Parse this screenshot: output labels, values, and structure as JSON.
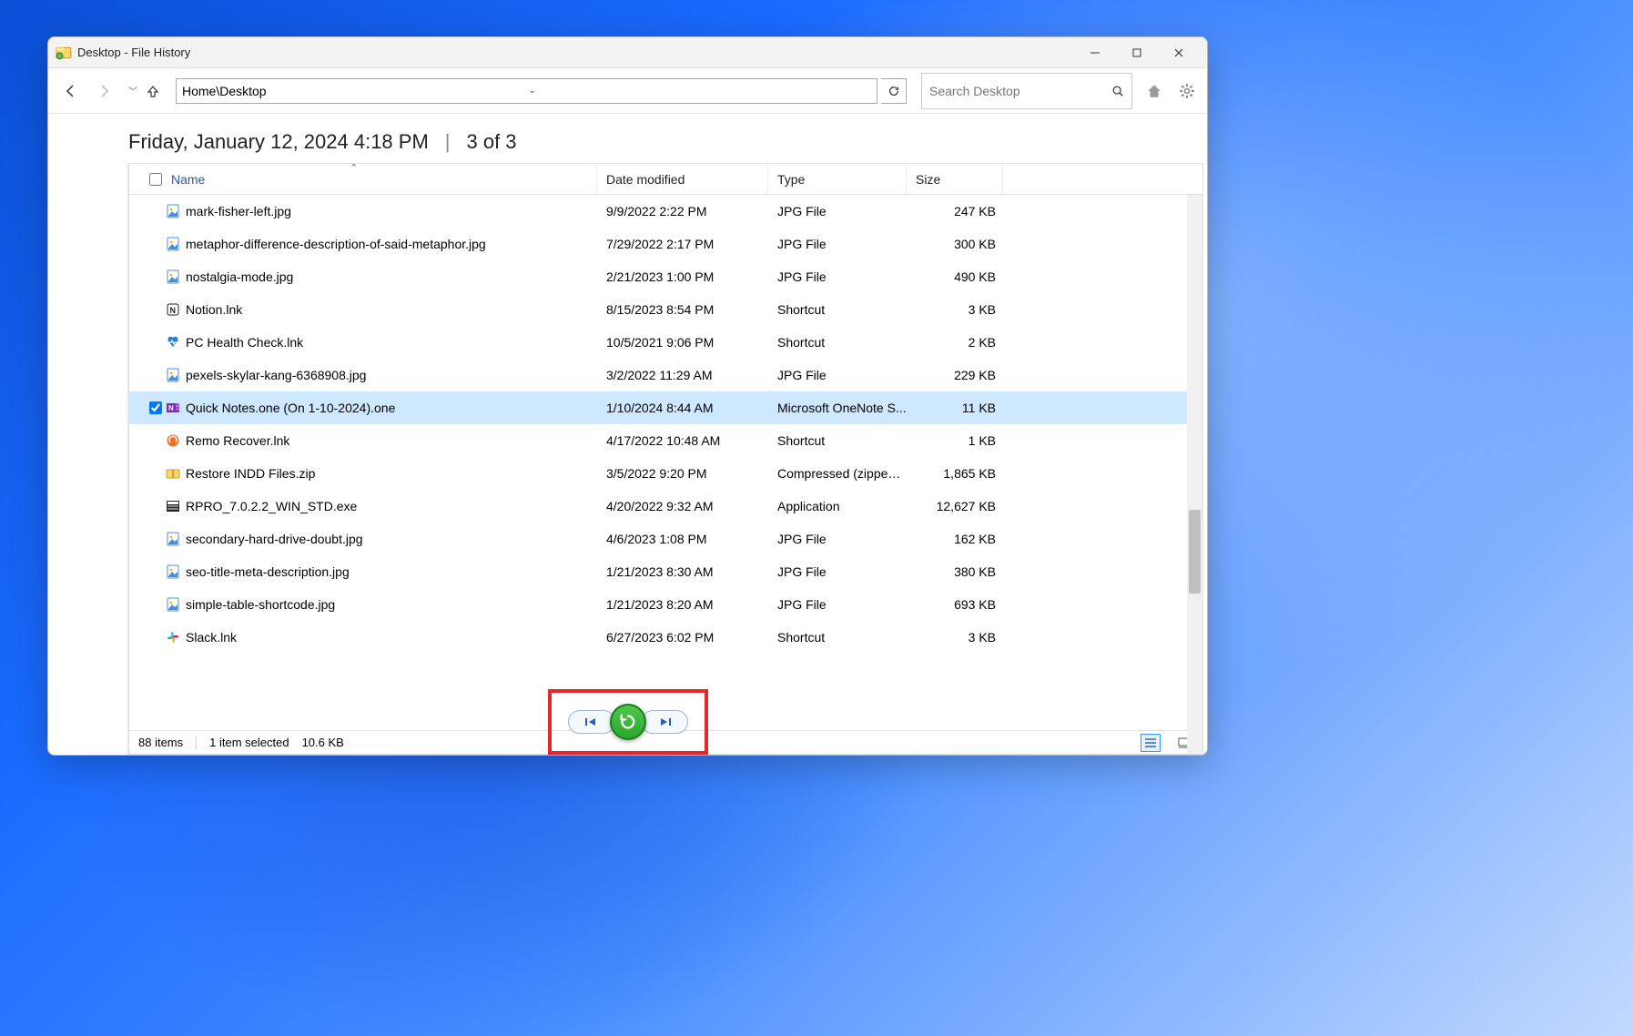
{
  "window": {
    "title": "Desktop - File History"
  },
  "toolbar": {
    "path": "Home\\Desktop",
    "search_placeholder": "Search Desktop"
  },
  "header": {
    "timestamp": "Friday, January 12, 2024 4:18 PM",
    "position": "3 of 3"
  },
  "columns": {
    "name": "Name",
    "date": "Date modified",
    "type": "Type",
    "size": "Size"
  },
  "files": [
    {
      "name": "mark-fisher-left.jpg",
      "date": "9/9/2022 2:22 PM",
      "type": "JPG File",
      "size": "247 KB",
      "icon": "jpg",
      "selected": false
    },
    {
      "name": "metaphor-difference-description-of-said-metaphor.jpg",
      "date": "7/29/2022 2:17 PM",
      "type": "JPG File",
      "size": "300 KB",
      "icon": "jpg",
      "selected": false
    },
    {
      "name": "nostalgia-mode.jpg",
      "date": "2/21/2023 1:00 PM",
      "type": "JPG File",
      "size": "490 KB",
      "icon": "jpg",
      "selected": false
    },
    {
      "name": "Notion.lnk",
      "date": "8/15/2023 8:54 PM",
      "type": "Shortcut",
      "size": "3 KB",
      "icon": "notion",
      "selected": false
    },
    {
      "name": "PC Health Check.lnk",
      "date": "10/5/2021 9:06 PM",
      "type": "Shortcut",
      "size": "2 KB",
      "icon": "pchealth",
      "selected": false
    },
    {
      "name": "pexels-skylar-kang-6368908.jpg",
      "date": "3/2/2022 11:29 AM",
      "type": "JPG File",
      "size": "229 KB",
      "icon": "jpg",
      "selected": false
    },
    {
      "name": "Quick Notes.one (On 1-10-2024).one",
      "date": "1/10/2024 8:44 AM",
      "type": "Microsoft OneNote S...",
      "size": "11 KB",
      "icon": "onenote",
      "selected": true
    },
    {
      "name": "Remo Recover.lnk",
      "date": "4/17/2022 10:48 AM",
      "type": "Shortcut",
      "size": "1 KB",
      "icon": "remo",
      "selected": false
    },
    {
      "name": "Restore INDD Files.zip",
      "date": "3/5/2022 9:20 PM",
      "type": "Compressed (zipped)...",
      "size": "1,865 KB",
      "icon": "zip",
      "selected": false
    },
    {
      "name": "RPRO_7.0.2.2_WIN_STD.exe",
      "date": "4/20/2022 9:32 AM",
      "type": "Application",
      "size": "12,627 KB",
      "icon": "exe",
      "selected": false
    },
    {
      "name": "secondary-hard-drive-doubt.jpg",
      "date": "4/6/2023 1:08 PM",
      "type": "JPG File",
      "size": "162 KB",
      "icon": "jpg",
      "selected": false
    },
    {
      "name": "seo-title-meta-description.jpg",
      "date": "1/21/2023 8:30 AM",
      "type": "JPG File",
      "size": "380 KB",
      "icon": "jpg",
      "selected": false
    },
    {
      "name": "simple-table-shortcode.jpg",
      "date": "1/21/2023 8:20 AM",
      "type": "JPG File",
      "size": "693 KB",
      "icon": "jpg",
      "selected": false
    },
    {
      "name": "Slack.lnk",
      "date": "6/27/2023 6:02 PM",
      "type": "Shortcut",
      "size": "3 KB",
      "icon": "slack",
      "selected": false
    }
  ],
  "status": {
    "total": "88 items",
    "selected": "1 item selected",
    "sel_size": "10.6 KB"
  }
}
